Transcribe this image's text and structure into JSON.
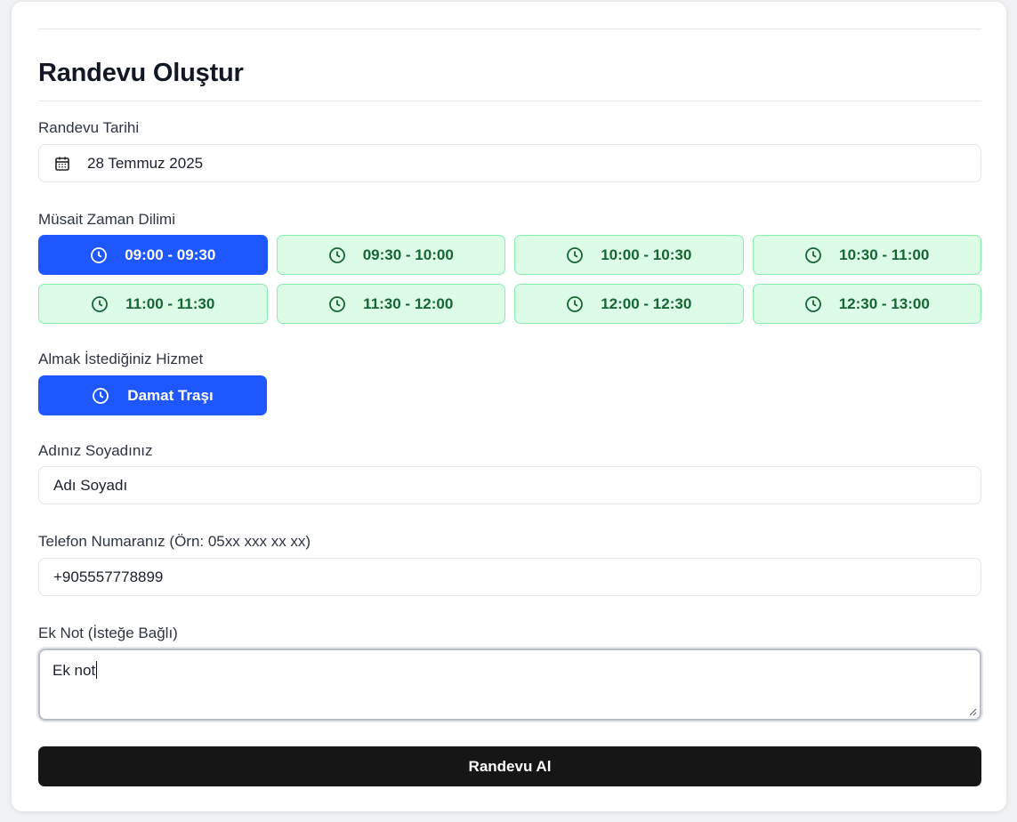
{
  "title": "Randevu Oluştur",
  "date": {
    "label": "Randevu Tarihi",
    "value": "28 Temmuz 2025",
    "icon": "calendar-icon"
  },
  "time_slots": {
    "label": "Müsait Zaman Dilimi",
    "icon": "clock-icon",
    "items": [
      {
        "label": "09:00 - 09:30",
        "state": "selected"
      },
      {
        "label": "09:30 - 10:00",
        "state": "available"
      },
      {
        "label": "10:00 - 10:30",
        "state": "available"
      },
      {
        "label": "10:30 - 11:00",
        "state": "available"
      },
      {
        "label": "11:00 - 11:30",
        "state": "available"
      },
      {
        "label": "11:30 - 12:00",
        "state": "available"
      },
      {
        "label": "12:00 - 12:30",
        "state": "available"
      },
      {
        "label": "12:30 - 13:00",
        "state": "available"
      }
    ]
  },
  "service": {
    "label": "Almak İstediğiniz Hizmet",
    "selected": "Damat Traşı",
    "icon": "clock-icon"
  },
  "name": {
    "label": "Adınız Soyadınız",
    "value": "Adı Soyadı"
  },
  "phone": {
    "label": "Telefon Numaranız (Örn: 05xx xxx xx xx)",
    "value": "+905557778899"
  },
  "note": {
    "label": "Ek Not (İsteğe Bağlı)",
    "value": "Ek not"
  },
  "submit_label": "Randevu Al",
  "colors": {
    "primary": "#1f57ff",
    "slot_available_bg": "#dcfce7",
    "slot_available_border": "#86efac",
    "slot_available_text": "#166534",
    "submit_bg": "#161616"
  }
}
